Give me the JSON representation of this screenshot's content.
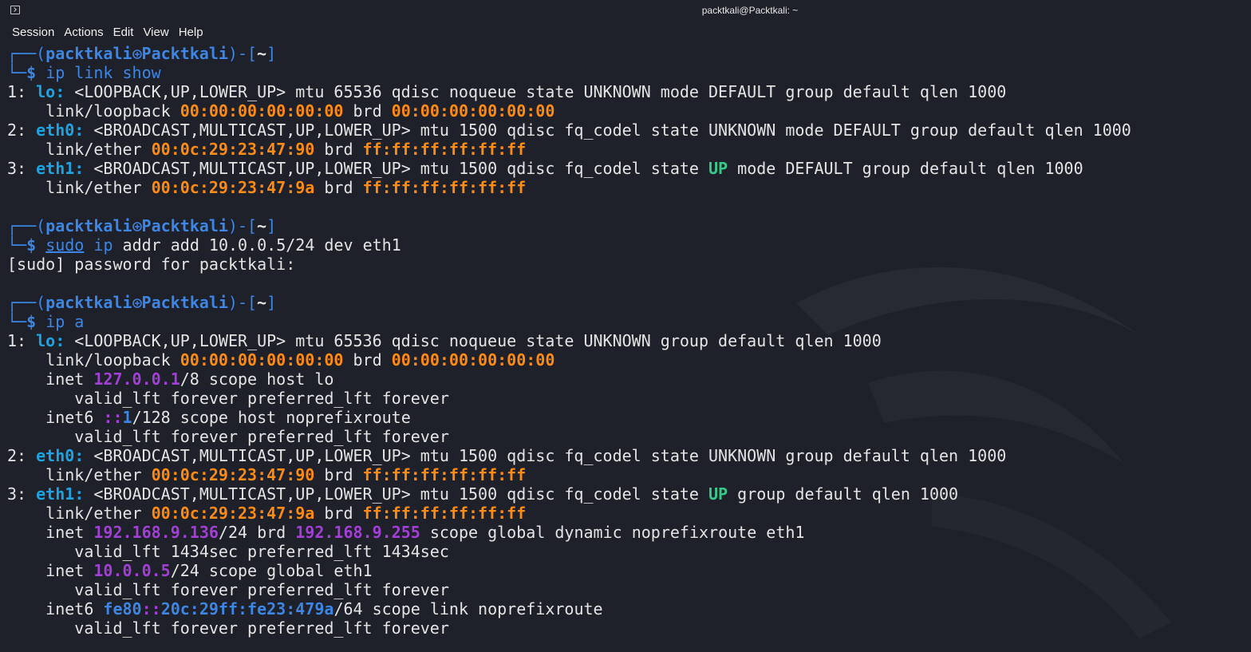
{
  "window": {
    "title": "packtkali@Packtkali: ~"
  },
  "menu": [
    "Session",
    "Actions",
    "Edit",
    "View",
    "Help"
  ],
  "prompt": {
    "user": "packtkali",
    "host": "Packtkali",
    "dir": "~",
    "symbol": "$"
  },
  "commands": {
    "cmd1": "ip link show",
    "cmd2_sudo": "sudo",
    "cmd2_rest": "addr add 10.0.0.5/24 dev eth1",
    "cmd2_ip": "ip",
    "sudo_prompt": "[sudo] password for packtkali:",
    "cmd3": "ip a"
  },
  "output": {
    "l1": [
      "1: ",
      "lo:",
      " <LOOPBACK,UP,LOWER_UP> mtu 65536 qdisc noqueue state UNKNOWN mode DEFAULT group default qlen 1000"
    ],
    "l2": [
      "    link/loopback ",
      "00:00:00:00:00:00",
      " brd ",
      "00:00:00:00:00:00"
    ],
    "l3": [
      "2: ",
      "eth0:",
      " <BROADCAST,MULTICAST,UP,LOWER_UP> mtu 1500 qdisc fq_codel state UNKNOWN mode DEFAULT group default qlen 1000"
    ],
    "l4": [
      "    link/ether ",
      "00:0c:29:23:47:90",
      " brd ",
      "ff:ff:ff:ff:ff:ff"
    ],
    "l5": [
      "3: ",
      "eth1:",
      " <BROADCAST,MULTICAST,UP,LOWER_UP> mtu 1500 qdisc fq_codel state ",
      "UP",
      " mode DEFAULT group default qlen 1000"
    ],
    "l6": [
      "    link/ether ",
      "00:0c:29:23:47:9a",
      " brd ",
      "ff:ff:ff:ff:ff:ff"
    ],
    "a1": [
      "1: ",
      "lo:",
      " <LOOPBACK,UP,LOWER_UP> mtu 65536 qdisc noqueue state UNKNOWN group default qlen 1000"
    ],
    "a2": [
      "    link/loopback ",
      "00:00:00:00:00:00",
      " brd ",
      "00:00:00:00:00:00"
    ],
    "a3": [
      "    inet ",
      "127.0.0.1",
      "/8 scope host lo"
    ],
    "a4": "       valid_lft forever preferred_lft forever",
    "a5": [
      "    inet6 ",
      "::",
      "1",
      "/128 scope host noprefixroute"
    ],
    "a6": "       valid_lft forever preferred_lft forever",
    "a7": [
      "2: ",
      "eth0:",
      " <BROADCAST,MULTICAST,UP,LOWER_UP> mtu 1500 qdisc fq_codel state UNKNOWN group default qlen 1000"
    ],
    "a8": [
      "    link/ether ",
      "00:0c:29:23:47:90",
      " brd ",
      "ff:ff:ff:ff:ff:ff"
    ],
    "a9": [
      "3: ",
      "eth1:",
      " <BROADCAST,MULTICAST,UP,LOWER_UP> mtu 1500 qdisc fq_codel state ",
      "UP",
      " group default qlen 1000"
    ],
    "a10": [
      "    link/ether ",
      "00:0c:29:23:47:9a",
      " brd ",
      "ff:ff:ff:ff:ff:ff"
    ],
    "a11": [
      "    inet ",
      "192.168.9.136",
      "/24 brd ",
      "192.168.9.255",
      " scope global dynamic noprefixroute eth1"
    ],
    "a12": "       valid_lft 1434sec preferred_lft 1434sec",
    "a13": [
      "    inet ",
      "10.0.0.5",
      "/24 scope global eth1"
    ],
    "a14": "       valid_lft forever preferred_lft forever",
    "a15": [
      "    inet6 ",
      "fe80",
      "::",
      "20c:29ff:fe23:479a",
      "/64 scope link noprefixroute"
    ],
    "a16": "       valid_lft forever preferred_lft forever"
  },
  "colors": {
    "background": "#1e2129",
    "prompt_frame": "#3d86e6",
    "mac_address": "#ff8a12",
    "ipv4_address": "#a33fd6",
    "interface_name": "#1ea3e0",
    "state_up": "#36c98a"
  }
}
